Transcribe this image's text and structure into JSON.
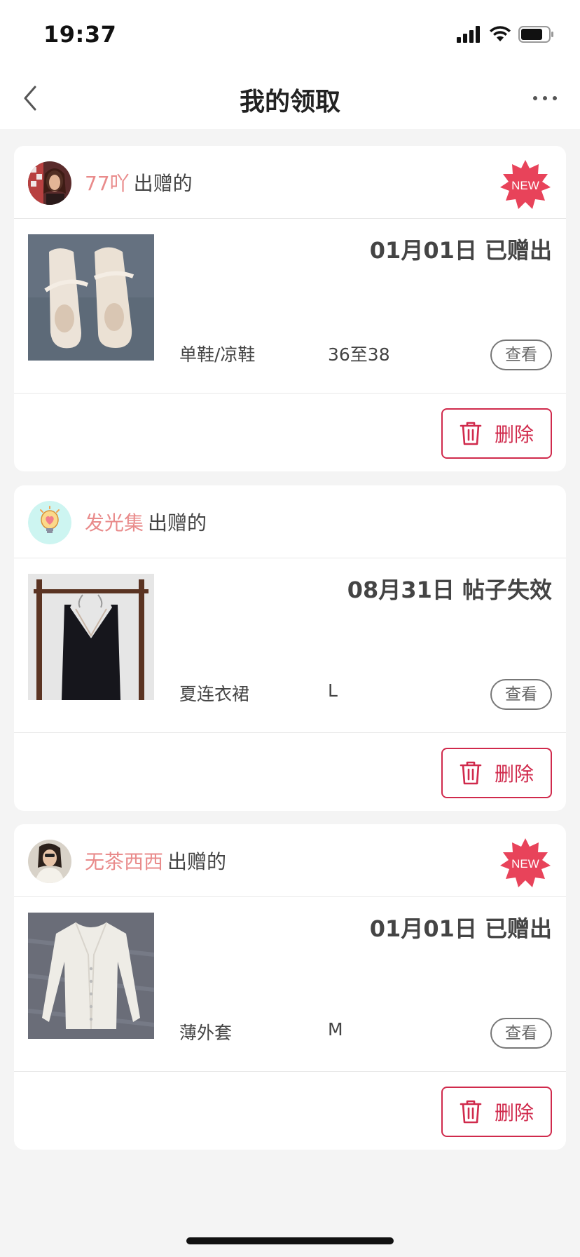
{
  "status_bar": {
    "time": "19:37"
  },
  "header": {
    "title": "我的领取"
  },
  "cards": [
    {
      "giver_name": "77吖",
      "giver_suffix": "出赠的",
      "has_new_badge": true,
      "status": "01月01日 已赠出",
      "category": "单鞋/凉鞋",
      "size": "36至38",
      "view_label": "查看",
      "delete_label": "删除",
      "thumbnail": "shoes-photo"
    },
    {
      "giver_name": "发光集",
      "giver_suffix": "出赠的",
      "has_new_badge": false,
      "status": "08月31日 帖子失效",
      "category": "夏连衣裙",
      "size": "L",
      "view_label": "查看",
      "delete_label": "删除",
      "thumbnail": "dress-photo"
    },
    {
      "giver_name": "无茶西西",
      "giver_suffix": "出赠的",
      "has_new_badge": true,
      "status": "01月01日 已赠出",
      "category": "薄外套",
      "size": "M",
      "view_label": "查看",
      "delete_label": "删除",
      "thumbnail": "cardigan-photo"
    }
  ],
  "badge": {
    "text": "NEW"
  },
  "colors": {
    "accent": "#d02a4c",
    "giver_name": "#e98b8b",
    "badge": "#e8435a",
    "background": "#f4f4f4"
  },
  "icons": {
    "back": "chevron-left-icon",
    "more": "more-horizontal-icon",
    "delete": "trash-icon"
  }
}
